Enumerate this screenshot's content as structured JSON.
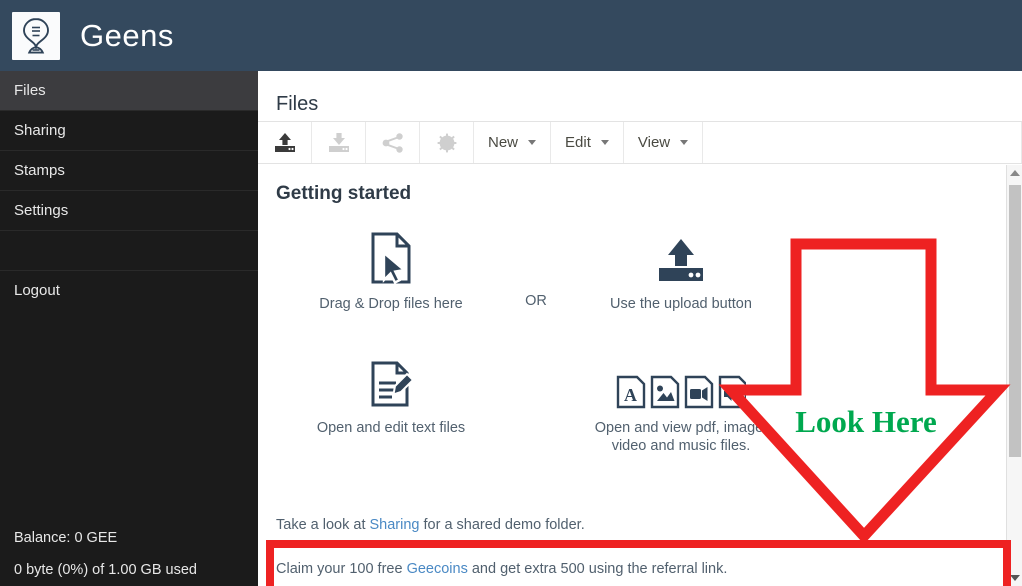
{
  "header": {
    "brand": "Geens",
    "logo_icon": "hourglass-pin-logo",
    "bg_color": "#34495e"
  },
  "sidebar": {
    "items": [
      {
        "label": "Files",
        "active": true
      },
      {
        "label": "Sharing",
        "active": false
      },
      {
        "label": "Stamps",
        "active": false
      },
      {
        "label": "Settings",
        "active": false
      }
    ],
    "logout_label": "Logout",
    "balance": "Balance: 0 GEE",
    "usage": "0 byte (0%) of 1.00 GB used",
    "bg_color": "#1b1b1b",
    "active_bg_color": "#3c3c3f"
  },
  "main": {
    "page_title": "Files",
    "toolbar": {
      "icon_buttons": [
        {
          "name": "upload-icon",
          "enabled": true
        },
        {
          "name": "download-icon",
          "enabled": false
        },
        {
          "name": "share-icon",
          "enabled": false
        },
        {
          "name": "stamp-icon",
          "enabled": false
        }
      ],
      "menus": [
        {
          "label": "New"
        },
        {
          "label": "Edit"
        },
        {
          "label": "View"
        }
      ]
    },
    "getting_started": {
      "title": "Getting started",
      "drag_drop_caption": "Drag & Drop files here",
      "or_label": "OR",
      "upload_caption": "Use the upload button",
      "edit_caption": "Open and edit text files",
      "view_caption_line1": "Open and view pdf, image,",
      "view_caption_line2": "video and music files.",
      "note1_before": "Take a look at ",
      "note1_link": "Sharing",
      "note1_after": " for a shared demo folder.",
      "note2_before": "Claim your 100 free ",
      "note2_link": "Geecoins",
      "note2_after": " and get extra 500 using the referral link."
    }
  },
  "annotation": {
    "look_here_label": "Look Here",
    "arrow_color": "#ee2222",
    "text_color": "#00a84f",
    "highlight_box_color": "#ee2222"
  }
}
